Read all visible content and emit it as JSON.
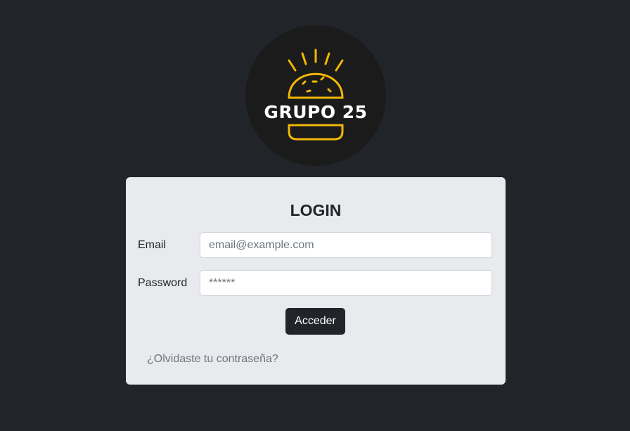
{
  "logo": {
    "text": "GRUPO 25",
    "icon": "burger-icon",
    "accent_color": "#f2b705"
  },
  "login": {
    "title": "LOGIN",
    "email_label": "Email",
    "email_placeholder": "email@example.com",
    "password_label": "Password",
    "password_placeholder": "******",
    "submit_label": "Acceder",
    "forgot_link": "¿Olvidaste tu contraseña?"
  },
  "colors": {
    "page_background": "#212429",
    "card_background": "#e8eaed",
    "button_background": "#212529"
  }
}
